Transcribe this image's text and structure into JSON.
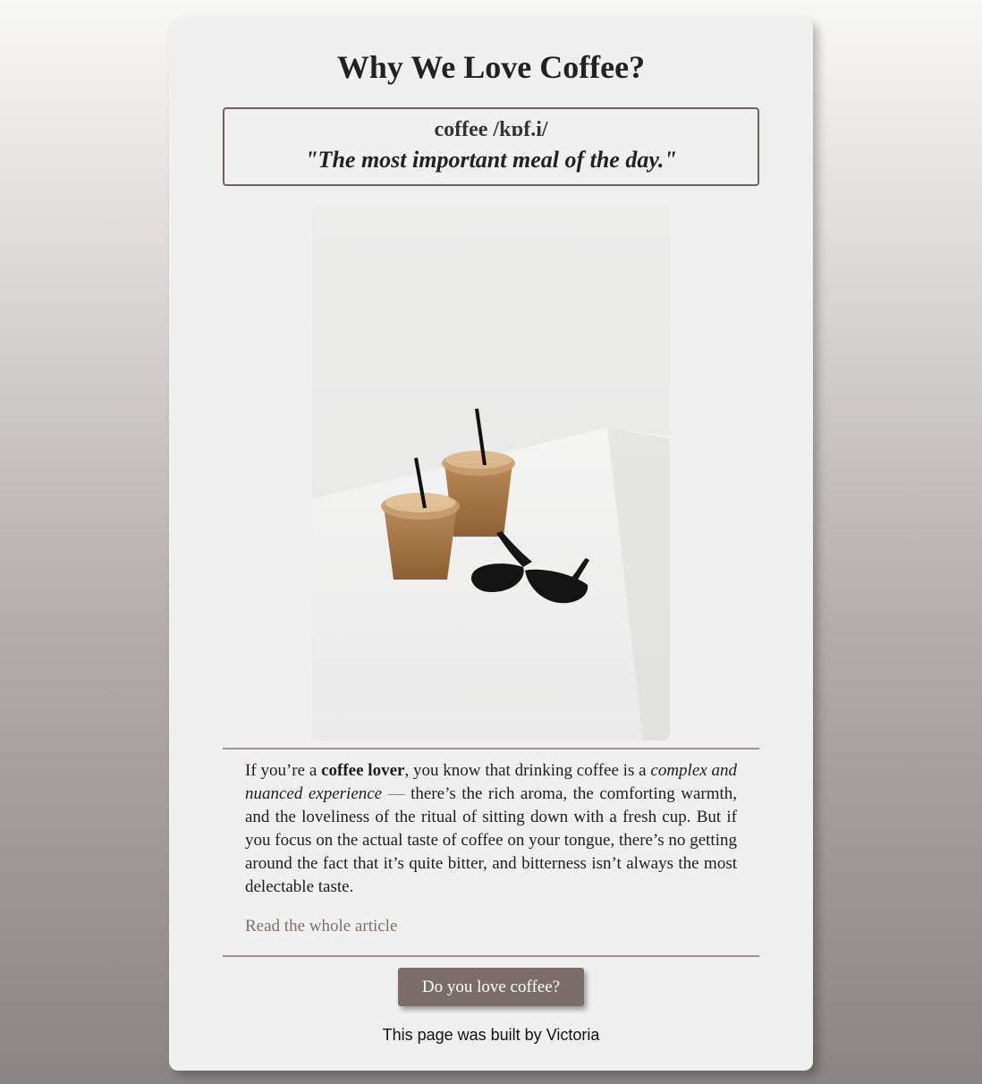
{
  "page": {
    "title": "Why We Love Coffee?"
  },
  "definition": {
    "word": "coffee /kɒf.i/",
    "quote": "\"The most important meal of the day.\""
  },
  "image": {
    "alt": "iced coffee cups and sunglasses"
  },
  "article": {
    "text_1": "If you’re a ",
    "bold": "coffee lover",
    "text_2": ", you know that drinking coffee is a ",
    "italic": "complex and nuanced experience",
    "dash": " — ",
    "text_3": "there’s the rich aroma, the comforting warmth, and the loveliness of the ritual of sitting down with a fresh cup. But if you focus on the actual taste of coffee on your tongue, there’s no getting around the fact that it’s quite bitter, and bitterness isn’t always the most delectable taste.",
    "link_label": "Read the whole article"
  },
  "cta": {
    "button_label": "Do you love coffee?"
  },
  "footer": {
    "text": "This page was built by Victoria"
  },
  "colors": {
    "accent": "#7b6e6a",
    "link": "#7c716c",
    "card": "#f0f0f0"
  }
}
